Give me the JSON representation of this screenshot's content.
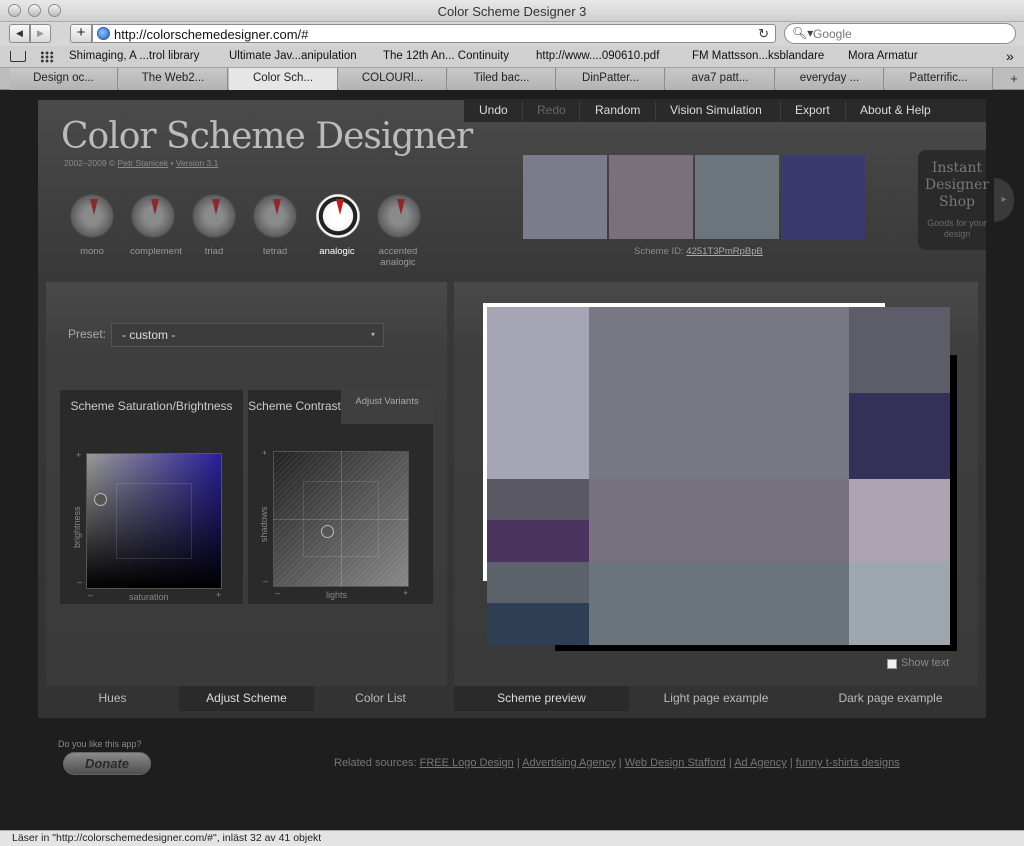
{
  "browser": {
    "window_title": "Color Scheme Designer 3",
    "back_icon": "◀",
    "forward_icon": "▶",
    "add_icon": "+",
    "url": "http://colorschemedesigner.com/#",
    "reload_icon": "↻",
    "search_icon": "🔍︎▾",
    "search_placeholder": "Google",
    "bookmarks": [
      "Shimaging, A ...trol library",
      "Ultimate Jav...anipulation",
      "The 12th An... Continuity",
      "http://www....090610.pdf",
      "FM Mattsson...ksblandare",
      "Mora Armatur"
    ],
    "bookmarks_more": "»",
    "tabs": [
      "Design oc...",
      "The Web2...",
      "Color Sch...",
      "COLOURl...",
      "Tiled bac...",
      "DinPatter...",
      "ava7 patt...",
      "everyday ...",
      "Patterrific..."
    ],
    "active_tab": 2,
    "tab_add": "+",
    "status": "Läser in \"http://colorschemedesigner.com/#\", inläst 32 av 41 objekt"
  },
  "app": {
    "menu": [
      "Undo",
      "Redo",
      "Random",
      "Vision Simulation",
      "Export",
      "About & Help"
    ],
    "logo": "Color Scheme Designer",
    "copyright_years": "2002–2009 ©",
    "author": "Petr Stanicek",
    "version": "Version 3.1",
    "scheme_types": [
      "mono",
      "complement",
      "triad",
      "tetrad",
      "analogic",
      "accented analogic"
    ],
    "active_scheme_type": 4,
    "swatch_colors": [
      "#7b7b8c",
      "#7a707c",
      "#6c747c",
      "#3a3a6e"
    ],
    "scheme_id_label": "Scheme ID:",
    "scheme_id": "4251T3PmRpBpB",
    "ad": {
      "title": "Instant Designer Shop",
      "subtitle": "Goods for your design",
      "arrow": "▸"
    },
    "preset_label": "Preset:",
    "preset_value": "- custom -",
    "preset_arrow": "▾",
    "sat_title": "Scheme Saturation/Brightness",
    "sat_x_label": "saturation",
    "sat_y_label": "brightness",
    "contrast_title": "Scheme Contrast",
    "adjust_variants": "Adjust Variants",
    "con_x_label": "lights",
    "con_y_label": "shadows",
    "plus": "+",
    "minus": "–",
    "left_tabs": [
      "Hues",
      "Adjust Scheme",
      "Color List"
    ],
    "left_active_tab": 1,
    "right_tabs": [
      "Scheme preview",
      "Light page example",
      "Dark page example"
    ],
    "right_active_tab": 0,
    "preview_colors": {
      "left": [
        "#a5a5b5",
        "#5a5862",
        "#4b355f",
        "#5c6269",
        "#2e3e55"
      ],
      "center": [
        "#777884",
        "#77717d",
        "#6a747b"
      ],
      "right": [
        "#5d5c69",
        "#343159",
        "#aca4b3",
        "#9ea6ae"
      ]
    },
    "show_text": "Show text",
    "donate_question": "Do you like this app?",
    "donate_label": "Donate",
    "related_label": "Related sources:",
    "related_links": [
      "FREE Logo Design",
      "Advertising Agency",
      "Web Design Stafford",
      "Ad Agency",
      "funny t-shirts designs"
    ]
  }
}
